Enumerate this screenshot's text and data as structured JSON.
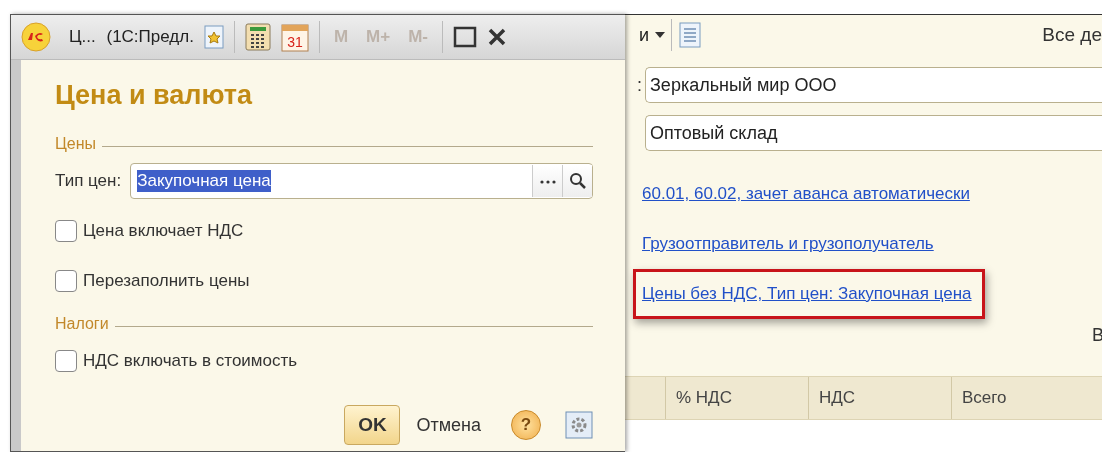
{
  "dialog": {
    "title": "Ц... (1С:Предл.",
    "calendar_day": "31",
    "memory_buttons": [
      {
        "label": "M",
        "disabled": true
      },
      {
        "label": "M+",
        "disabled": true
      },
      {
        "label": "M-",
        "disabled": true
      }
    ],
    "heading": "Цена и валюта",
    "sections": [
      {
        "title": "Цены",
        "items": [
          {
            "kind": "field",
            "label": "Тип цен:",
            "value": "Закупочная цена",
            "text_selected": true
          },
          {
            "kind": "checkbox",
            "label": "Цена включает НДС",
            "checked": false
          },
          {
            "kind": "checkbox",
            "label": "Перезаполнить цены",
            "checked": false
          }
        ]
      },
      {
        "title": "Налоги",
        "items": [
          {
            "kind": "checkbox",
            "label": "НДС включать в стоимость",
            "checked": false
          }
        ]
      }
    ],
    "ok": "OK",
    "cancel": "Отмена",
    "help": "?"
  },
  "document": {
    "menu_label": "и",
    "right_text": "Все де",
    "fields": [
      {
        "prefix": ":",
        "value": "Зеркальный мир ООО"
      },
      {
        "value": "Оптовый склад"
      }
    ],
    "links": [
      {
        "text": "60.01, 60.02, зачет аванса автоматически",
        "highlighted": false
      },
      {
        "text": "Грузоотправитель и грузополучатель",
        "highlighted": false
      },
      {
        "text": "Цены без НДС, Тип цен: Закупочная цена",
        "highlighted": true
      }
    ],
    "side_text": "В",
    "columns": [
      "% НДС",
      "НДС",
      "Всего"
    ]
  }
}
